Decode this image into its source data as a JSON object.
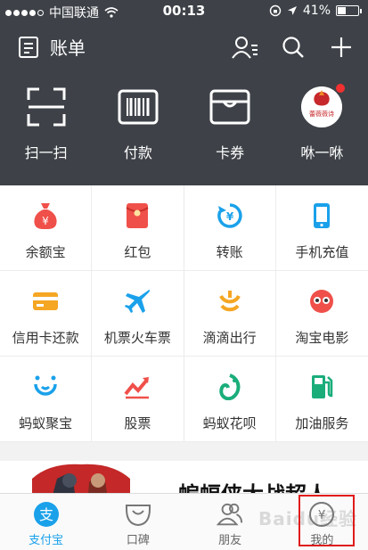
{
  "status_bar": {
    "carrier": "中国联通",
    "time": "00:13",
    "battery": "41%",
    "signal_bars_filled": 4,
    "battery_level": 0.41
  },
  "header": {
    "title": "账单",
    "icons": [
      "bill-icon",
      "contacts-icon",
      "search-icon",
      "plus-icon"
    ]
  },
  "quick_actions": [
    {
      "label": "扫一扫",
      "icon": "scan-icon"
    },
    {
      "label": "付款",
      "icon": "barcode-icon"
    },
    {
      "label": "卡券",
      "icon": "card-wallet-icon"
    },
    {
      "label": "咻一咻",
      "icon": "brand-avatar"
    }
  ],
  "avatar_text": "蕾薇薇诗",
  "services": [
    {
      "label": "余额宝",
      "icon": "money-bag-icon",
      "color": "#f0504a"
    },
    {
      "label": "红包",
      "icon": "red-envelope-icon",
      "color": "#f0504a"
    },
    {
      "label": "转账",
      "icon": "transfer-icon",
      "color": "#1aa1ea"
    },
    {
      "label": "手机充值",
      "icon": "phone-icon",
      "color": "#1aa1ea"
    },
    {
      "label": "信用卡还款",
      "icon": "credit-card-icon",
      "color": "#f5a623"
    },
    {
      "label": "机票火车票",
      "icon": "plane-icon",
      "color": "#1aa1ea"
    },
    {
      "label": "滴滴出行",
      "icon": "didi-icon",
      "color": "#f5a623"
    },
    {
      "label": "淘宝电影",
      "icon": "movie-glasses-icon",
      "color": "#f0504a"
    },
    {
      "label": "蚂蚁聚宝",
      "icon": "ant-treasure-icon",
      "color": "#1aa1ea"
    },
    {
      "label": "股票",
      "icon": "stock-chart-icon",
      "color": "#f0504a"
    },
    {
      "label": "蚂蚁花呗",
      "icon": "huabei-icon",
      "color": "#1aad7a"
    },
    {
      "label": "加油服务",
      "icon": "fuel-pump-icon",
      "color": "#1aad7a"
    }
  ],
  "banner": {
    "text": "蝙蝠侠大战超人"
  },
  "tabs": [
    {
      "label": "支付宝",
      "icon": "alipay-icon",
      "active": true
    },
    {
      "label": "口碑",
      "icon": "koubei-icon",
      "active": false
    },
    {
      "label": "朋友",
      "icon": "friends-icon",
      "active": false
    },
    {
      "label": "我的",
      "icon": "mine-icon",
      "active": false
    }
  ],
  "watermark": "Baidu经验",
  "colors": {
    "header_bg": "#3e4248",
    "accent": "#1aa1ea",
    "highlight_box": "#e01b1b"
  }
}
